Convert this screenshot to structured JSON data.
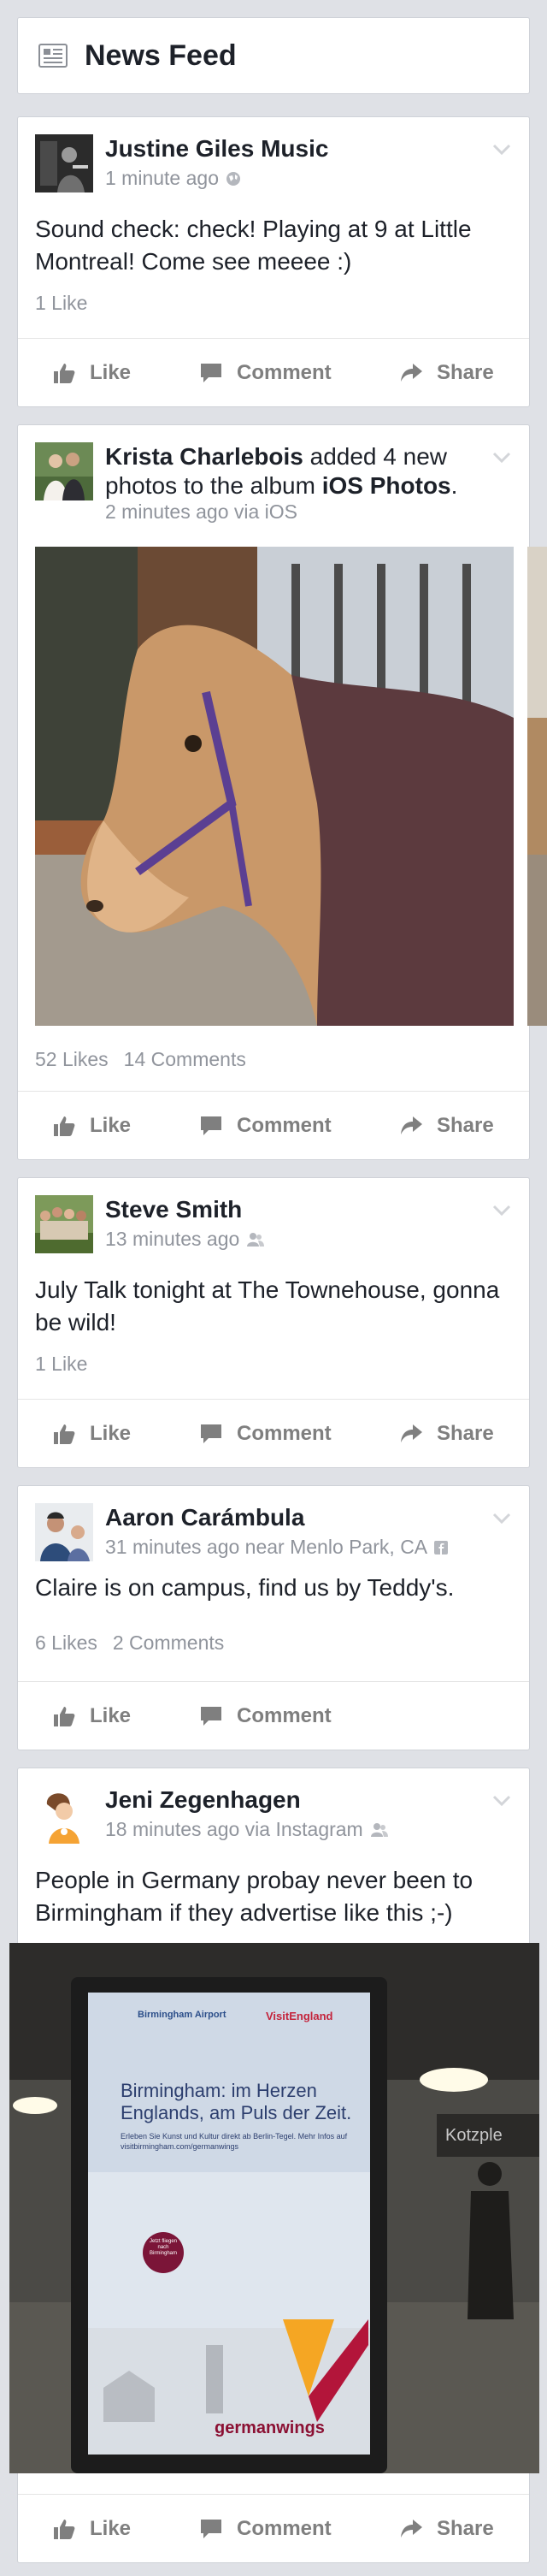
{
  "header": {
    "title": "News Feed",
    "icon": "news-feed-icon"
  },
  "actions": {
    "like": "Like",
    "comment": "Comment",
    "share": "Share"
  },
  "posts": [
    {
      "author": "Justine Giles Music",
      "time": "1 minute ago",
      "privacy_icon": "globe-icon",
      "text": "Sound check: check! Playing at 9 at Little Montreal! Come see meeee :)",
      "likes": "1 Like"
    },
    {
      "author": "Krista Charlebois",
      "action_text": " added 4 new photos to the album ",
      "album": "iOS Photos",
      "period": ".",
      "time": "2 minutes ago via iOS",
      "likes": "52 Likes",
      "comments": "14 Comments"
    },
    {
      "author": "Steve Smith",
      "time": "13 minutes ago",
      "privacy_icon": "friends-icon",
      "text": "July Talk tonight at The Townehouse, gonna be wild!",
      "likes": "1 Like"
    },
    {
      "author": "Aaron Carámbula",
      "time": "31 minutes ago near Menlo Park, CA",
      "privacy_icon": "facebook-icon",
      "text": "Claire is on campus, find us by Teddy's.",
      "likes": "6 Likes",
      "comments": "2 Comments"
    },
    {
      "author": "Jeni Zegenhagen",
      "time": "18 minutes ago via Instagram",
      "privacy_icon": "friends-icon",
      "text": "People in Germany probay never been to Birmingham if they advertise like this ;-)"
    }
  ],
  "ad_poster": {
    "brand_top_left": "Birmingham Airport",
    "brand_top_right": "VisitEngland",
    "headline": "Birmingham: im Herzen Englands, am Puls der Zeit.",
    "subline": "Erleben Sie Kunst und Kultur direkt ab Berlin-Tegel. Mehr Infos auf visitbirmingham.com/germanwings",
    "badge": "Jetzt fliegen nach Birmingham",
    "brand": "germanwings",
    "sign_text": "Kotzple"
  },
  "colors": {
    "background": "#dfe1e6",
    "card": "#ffffff",
    "meta_gray": "#90949c",
    "action_gray": "#7f7f7f"
  }
}
